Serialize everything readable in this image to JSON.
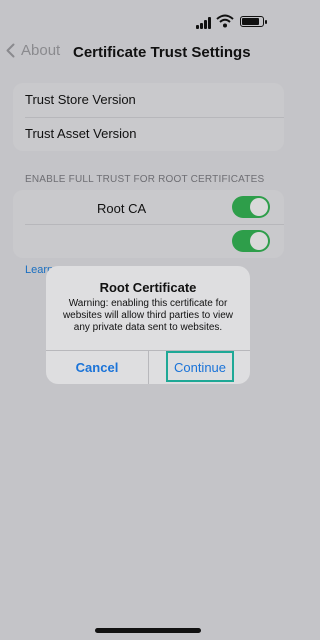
{
  "nav": {
    "back_label": "About",
    "title": "Certificate Trust Settings"
  },
  "group1": {
    "items": [
      {
        "label": "Trust Store Version"
      },
      {
        "label": "Trust Asset Version"
      }
    ]
  },
  "section": {
    "header": "ENABLE FULL TRUST FOR ROOT CERTIFICATES"
  },
  "certs": {
    "items": [
      {
        "label": "Root CA",
        "enabled": true
      },
      {
        "label": "",
        "enabled": true
      }
    ]
  },
  "learn_more": "Learn",
  "alert": {
    "title": "Root Certificate",
    "message": "Warning: enabling this certificate for websites will allow third parties to view any private data sent to websites.",
    "cancel_label": "Cancel",
    "continue_label": "Continue"
  },
  "colors": {
    "accent": "#1a73d8",
    "toggle_on": "#2e9e4a",
    "highlight": "#1ea896"
  }
}
